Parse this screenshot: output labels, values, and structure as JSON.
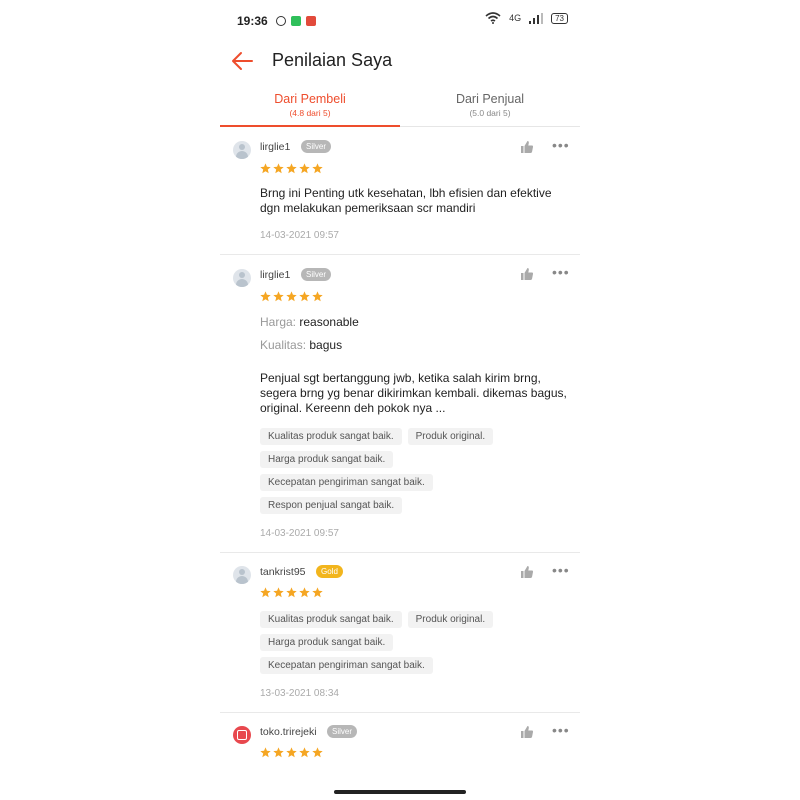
{
  "status": {
    "time": "19:36",
    "network": "4G",
    "battery": "73"
  },
  "header": {
    "title": "Penilaian Saya"
  },
  "tabs": [
    {
      "label": "Dari Pembeli",
      "sub": "(4.8 dari 5)",
      "active": true
    },
    {
      "label": "Dari Penjual",
      "sub": "(5.0 dari 5)",
      "active": false
    }
  ],
  "colors": {
    "accent": "#ee4d2d",
    "star": "#f5a623",
    "silver_badge": "#b7b7b7",
    "gold_badge": "#f2b51d"
  },
  "reviews": [
    {
      "user": "lirglie1",
      "badge": "Silver",
      "rating": 5,
      "text": "Brng ini Penting utk kesehatan, lbh efisien dan efektive dgn melakukan pemeriksaan scr mandiri",
      "date": "14-03-2021 09:57"
    },
    {
      "user": "lirglie1",
      "badge": "Silver",
      "rating": 5,
      "price_label": "Harga:",
      "price_value": "reasonable",
      "quality_label": "Kualitas:",
      "quality_value": "bagus",
      "text": "Penjual sgt  bertanggung jwb, ketika salah kirim brng, segera brng yg benar dikirimkan kembali. dikemas bagus, original. Kereenn deh pokok nya ...",
      "tags": [
        "Kualitas produk sangat baik.",
        "Produk original.",
        "Harga produk sangat baik.",
        "Kecepatan pengiriman sangat baik.",
        "Respon penjual sangat baik."
      ],
      "date": "14-03-2021 09:57"
    },
    {
      "user": "tankrist95",
      "badge": "Gold",
      "rating": 5,
      "tags": [
        "Kualitas produk sangat baik.",
        "Produk original.",
        "Harga produk sangat baik.",
        "Kecepatan pengiriman sangat baik."
      ],
      "date": "13-03-2021 08:34"
    },
    {
      "user": "toko.trirejeki",
      "badge": "Silver",
      "rating": 5
    }
  ]
}
